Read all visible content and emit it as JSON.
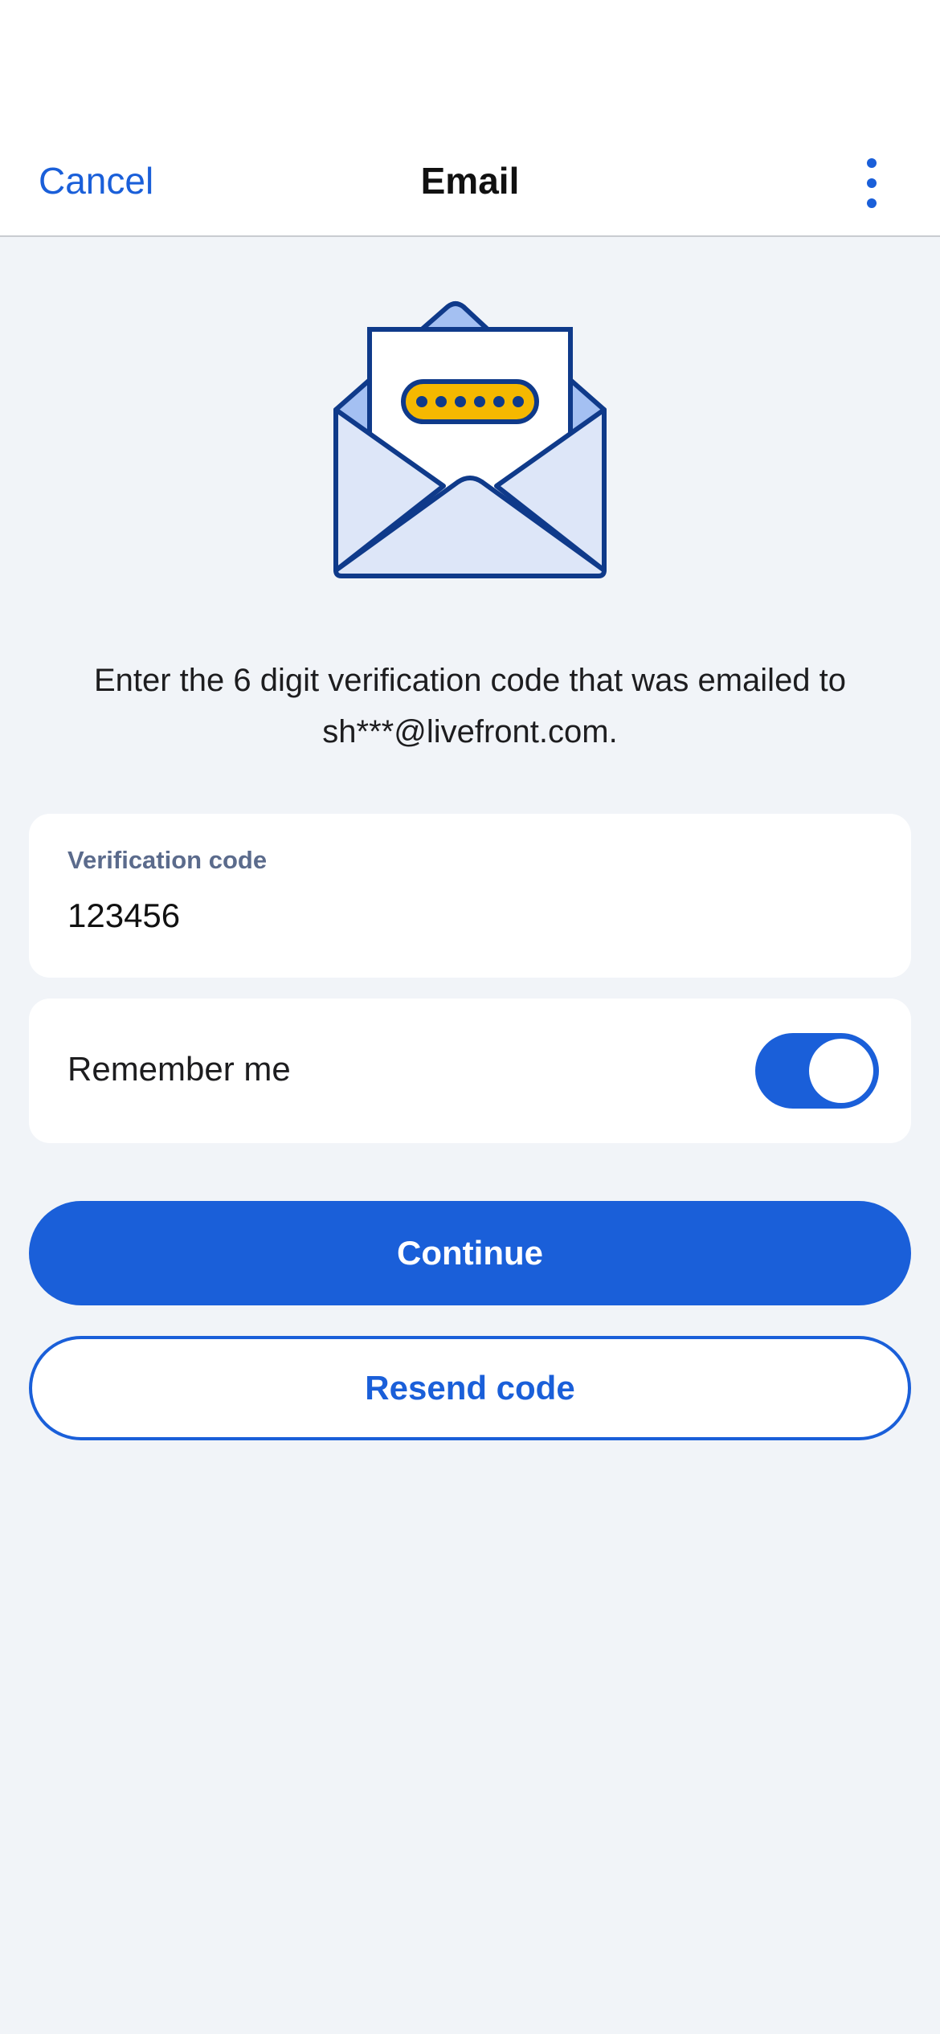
{
  "header": {
    "cancel_label": "Cancel",
    "title": "Email",
    "menu_icon": "more-vertical-icon"
  },
  "illustration": {
    "icon": "envelope-code-icon"
  },
  "description": "Enter the 6 digit verification code that was emailed to sh***@livefront.com.",
  "verification": {
    "label": "Verification code",
    "value": "123456"
  },
  "remember": {
    "label": "Remember me",
    "enabled": true
  },
  "actions": {
    "continue_label": "Continue",
    "resend_label": "Resend code"
  },
  "colors": {
    "accent": "#1a5fd9",
    "background": "#f1f4f8",
    "envelope_outline": "#0f3a8a",
    "code_pill": "#f5b800"
  }
}
